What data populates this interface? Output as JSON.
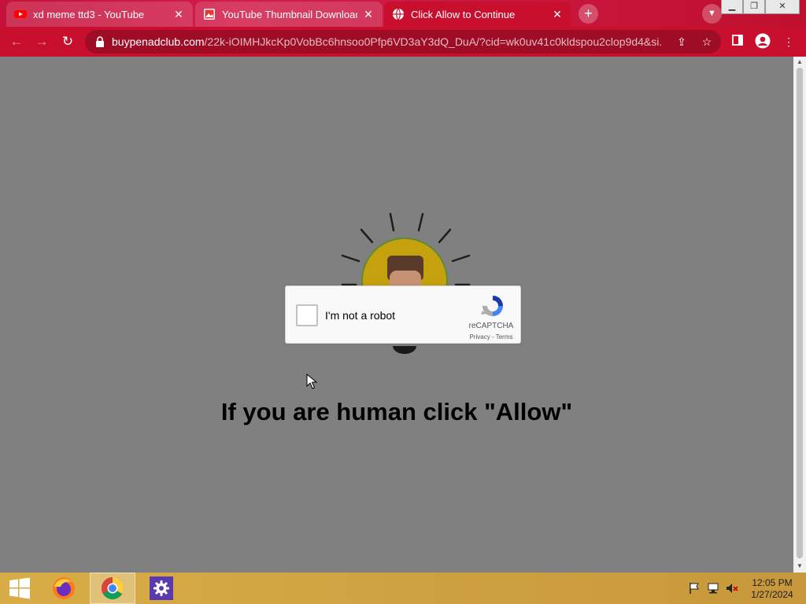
{
  "tabs": [
    {
      "title": "xd meme ttd3 - YouTube",
      "favicon": "youtube-icon"
    },
    {
      "title": "YouTube Thumbnail Downloader",
      "favicon": "image-icon"
    },
    {
      "title": "Click Allow to Continue",
      "favicon": "globe-icon"
    }
  ],
  "tab_close_glyph": "✕",
  "toolbar": {
    "url_host": "buypenadclub.com",
    "url_path": "/22k-iOIMHJkcKp0VobBc6hnsoo0Pfp6VD3aY3dQ_DuA/?cid=wk0uv41c0kldspou2clop9d4&si..."
  },
  "captcha": {
    "checkbox_label": "I'm not a robot",
    "brand": "reCAPTCHA",
    "links": "Privacy - Terms"
  },
  "headline": "If you are human click \"Allow\"",
  "clock": {
    "time": "12:05 PM",
    "date": "1/27/2024"
  },
  "colors": {
    "chrome_accent": "#c8102e",
    "page_background": "#808080",
    "taskbar": "#d4a843"
  }
}
